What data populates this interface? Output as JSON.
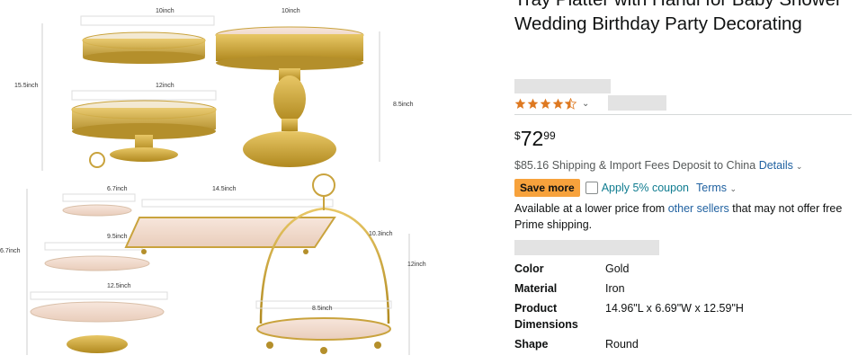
{
  "product": {
    "title": "Tray Platter with Handl for Baby Shower Wedding Birthday Party Decorating",
    "rating": 4.5,
    "price_symbol": "$",
    "price_whole": "72",
    "price_fraction": "99",
    "shipping_text": "$85.16 Shipping & Import Fees Deposit to China",
    "details_link": "Details",
    "save_more_label": "Save more",
    "coupon_label": "Apply 5% coupon",
    "terms_label": "Terms",
    "availability_prefix": "Available at a lower price from ",
    "availability_link": "other sellers",
    "availability_suffix": " that may not offer free Prime shipping.",
    "specs": [
      {
        "key": "Color",
        "value": "Gold"
      },
      {
        "key": "Material",
        "value": "Iron"
      },
      {
        "key": "Product Dimensions",
        "value": "14.96\"L x 6.69\"W x 12.59\"H"
      },
      {
        "key": "Shape",
        "value": "Round"
      }
    ]
  },
  "image_labels": {
    "top_width_1": "10inch",
    "top_width_2": "10inch",
    "left_height_1": "15.5inch",
    "tier_width": "12inch",
    "stand_height": "8.5inch",
    "small_tier_1": "6.7inch",
    "tray_width": "14.5inch",
    "left_height_2": "6.7inch",
    "small_tier_2": "9.5inch",
    "handle_height": "10.3inch",
    "total_height": "12inch",
    "small_tier_3": "12.5inch",
    "round_tray": "8.5inch"
  },
  "colors": {
    "gold": "#c9a33d",
    "gold_dark": "#9c7a22",
    "link": "#2162a1",
    "badge": "#f7a23c",
    "star": "#de7921"
  }
}
